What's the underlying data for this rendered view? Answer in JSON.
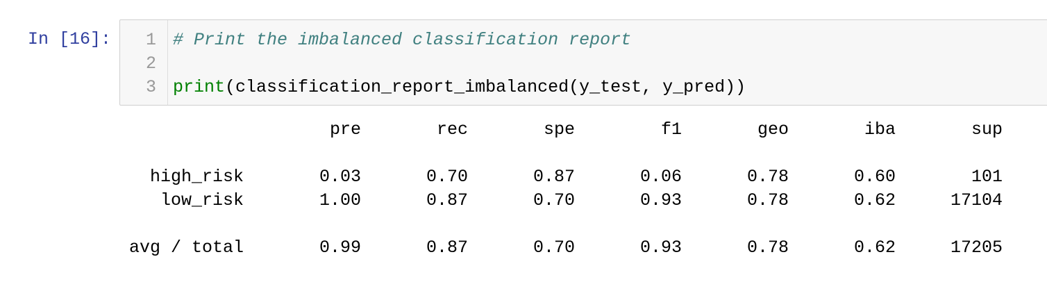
{
  "cell": {
    "prompt": "In [16]:",
    "line_numbers": [
      "1",
      "2",
      "3"
    ],
    "lines": [
      {
        "comment": "# Print the imbalanced classification report"
      },
      {},
      {
        "builtin": "print",
        "rest": "(classification_report_imbalanced(y_test, y_pred))"
      }
    ]
  },
  "output": {
    "headers": [
      "pre",
      "rec",
      "spe",
      "f1",
      "geo",
      "iba",
      "sup"
    ],
    "rows": [
      {
        "label": "high_risk",
        "values": [
          "0.03",
          "0.70",
          "0.87",
          "0.06",
          "0.78",
          "0.60",
          "101"
        ]
      },
      {
        "label": "low_risk",
        "values": [
          "1.00",
          "0.87",
          "0.70",
          "0.93",
          "0.78",
          "0.62",
          "17104"
        ]
      },
      {
        "label": "avg / total",
        "values": [
          "0.99",
          "0.87",
          "0.70",
          "0.93",
          "0.78",
          "0.62",
          "17205"
        ]
      }
    ]
  }
}
